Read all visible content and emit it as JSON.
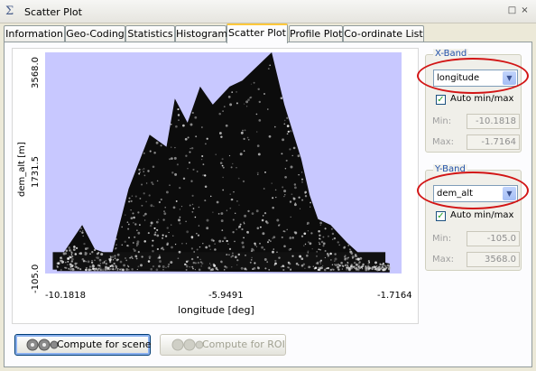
{
  "window": {
    "title": "Scatter Plot",
    "controls": [
      "□",
      "×"
    ]
  },
  "tabs": [
    {
      "label": "Information",
      "active": false
    },
    {
      "label": "Geo-Coding",
      "active": false
    },
    {
      "label": "Statistics",
      "active": false
    },
    {
      "label": "Histogram",
      "active": false
    },
    {
      "label": "Scatter Plot",
      "active": true
    },
    {
      "label": "Profile Plot",
      "active": false
    },
    {
      "label": "Co-ordinate List",
      "active": false
    }
  ],
  "chart_data": {
    "type": "scatter",
    "title": "",
    "xlabel": "longitude [deg]",
    "ylabel": "dem_alt [m]",
    "xlim": [
      -10.1818,
      -1.7164
    ],
    "ylim": [
      -105.0,
      3568.0
    ],
    "xticks": [
      "-10.1818",
      "-5.9491",
      "-1.7164"
    ],
    "yticks": [
      "-105.0",
      "1731.5",
      "3568.0"
    ],
    "background_color": "#c8c8ff",
    "density_envelope": {
      "x": [
        -9.9,
        -9.3,
        -9.0,
        -8.6,
        -8.2,
        -7.7,
        -7.3,
        -7.1,
        -6.8,
        -6.5,
        -6.2,
        -5.8,
        -5.5,
        -5.2,
        -4.8,
        -4.5,
        -4.1,
        -3.9,
        -3.7,
        -3.4,
        -3.0,
        -2.6,
        -2.0
      ],
      "y": [
        80,
        700,
        300,
        200,
        1300,
        2200,
        2000,
        2800,
        2400,
        3000,
        2700,
        3000,
        3100,
        3300,
        3568,
        2700,
        1800,
        1200,
        800,
        700,
        400,
        150,
        60
      ]
    }
  },
  "xband": {
    "legend": "X-Band",
    "selected": "longitude",
    "auto_label": "Auto min/max",
    "auto_checked": true,
    "min_label": "Min:",
    "min_value": "-10.1818",
    "max_label": "Max:",
    "max_value": "-1.7164"
  },
  "yband": {
    "legend": "Y-Band",
    "selected": "dem_alt",
    "auto_label": "Auto min/max",
    "auto_checked": true,
    "min_label": "Min:",
    "min_value": "-105.0",
    "max_label": "Max:",
    "max_value": "3568.0"
  },
  "buttons": {
    "compute_scene": "Compute for scene",
    "compute_roi": "Compute for ROI"
  },
  "icons": {
    "window": "sigma-icon",
    "compute": "gears-icon",
    "dropdown": "chevron-down-icon"
  },
  "colors": {
    "highlight_ellipse": "#d21515",
    "active_tab_accent": "#ffc83c",
    "group_legend": "#2050a8"
  }
}
